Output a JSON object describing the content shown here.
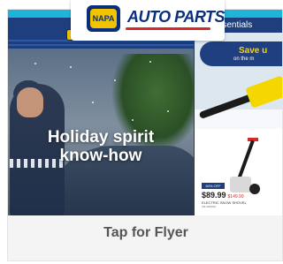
{
  "logo": {
    "badge_text": "NAPA",
    "wordmark": "AUTO PARTS"
  },
  "flyer": {
    "headline_line1": "Holiday spirit",
    "headline_line2": "know-how",
    "side_title": "er Essentials",
    "promo_line1": "Save u",
    "promo_line2": "on the m",
    "deal_tag": "60% OFF",
    "price": "$89.99",
    "was_price": "$149.99",
    "product_name": "ELECTRIC SNOW SHOVEL",
    "product_sku": "(99-390904)"
  },
  "cta": {
    "label": "Tap for Flyer"
  },
  "colors": {
    "brand_navy": "#0a2e7a",
    "brand_yellow": "#f2c300",
    "accent_cyan": "#1fb5d8",
    "accent_red": "#d62828"
  }
}
